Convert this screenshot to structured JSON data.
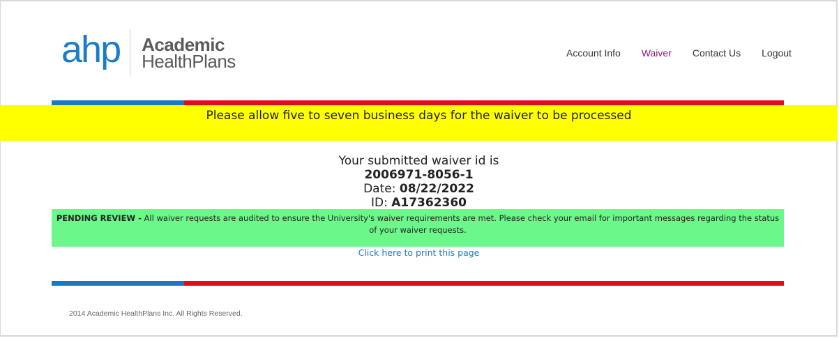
{
  "brand": {
    "mark": "ahp",
    "name_line1": "Academic",
    "name_line2": "HealthPlans"
  },
  "nav": {
    "items": [
      {
        "label": "Account Info",
        "active": false
      },
      {
        "label": "Waiver",
        "active": true
      },
      {
        "label": "Contact Us",
        "active": false
      },
      {
        "label": "Logout",
        "active": false
      }
    ]
  },
  "notice": {
    "text": "Please allow five to seven business days for the waiver to be processed"
  },
  "confirmation": {
    "intro": "Your submitted waiver id is",
    "waiver_id": "2006971-8056-1",
    "date_label": "Date:",
    "date_value": "08/22/2022",
    "id_label": "ID:",
    "id_value": "A17362360"
  },
  "pending": {
    "status": "PENDING REVIEW -",
    "message": "All waiver requests are audited to ensure the University's waiver requirements are met. Please check your email for important messages regarding the status of your waiver requests."
  },
  "print_link": "Click here to print this page",
  "footer": "2014 Academic HealthPlans Inc. All Rights Reserved.",
  "colors": {
    "brand_blue": "#1b78c2",
    "brand_red": "#e00b1c",
    "notice_yellow": "#ffff00",
    "pending_green": "#6cf78a",
    "nav_active": "#8a1c7a"
  }
}
